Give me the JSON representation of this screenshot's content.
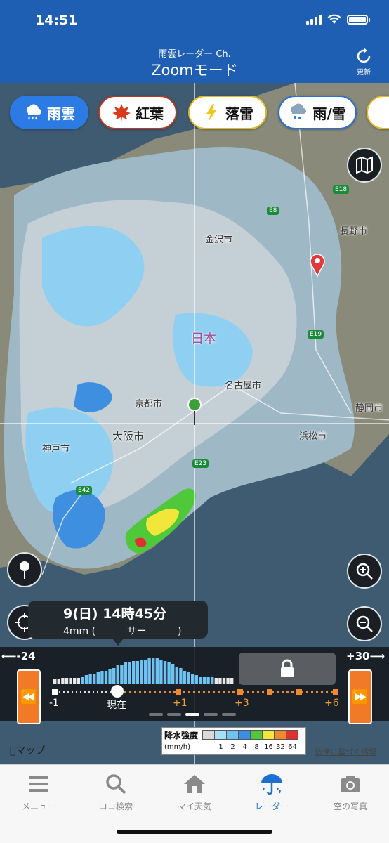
{
  "status": {
    "time": "14:51"
  },
  "header": {
    "subtitle": "雨雲レーダー Ch.",
    "title": "Zoomモード",
    "refresh_label": "更新"
  },
  "layers": [
    {
      "label": "雨雲",
      "icon": "rain-cloud-icon",
      "active": true
    },
    {
      "label": "紅葉",
      "icon": "maple-leaf-icon",
      "active": false
    },
    {
      "label": "落雷",
      "icon": "lightning-icon",
      "active": false
    },
    {
      "label": "雨/雪",
      "icon": "snow-rain-icon",
      "active": false
    }
  ],
  "map_labels": {
    "kanazawa": "金沢市",
    "nihon": "日本",
    "nagoya": "名古屋市",
    "kyoto": "京都市",
    "osaka": "大阪市",
    "kobe": "神戸市",
    "hamamatsu": "浜松市",
    "shizuoka": "静岡市",
    "nagano": "長野市",
    "e8": "E8",
    "e18": "E18",
    "e19": "E19",
    "e23": "E23",
    "e42": "E42"
  },
  "tooltip": {
    "time": "9(日) 14時45分",
    "amount": "4mm (",
    "type": "サー",
    "close": ")"
  },
  "timeline": {
    "left_label": "-24",
    "right_label": "+30",
    "ticks": {
      "minus1": "-1",
      "now": "現在",
      "plus1": "+1",
      "plus3": "+3",
      "plus6": "+6"
    }
  },
  "legend": {
    "title": "降水強度",
    "unit": "(mm/h)",
    "values": [
      "1",
      "2",
      "4",
      "8",
      "16",
      "32",
      "64"
    ],
    "colors": [
      "#d9d9d9",
      "#a6e0f7",
      "#6fc3f2",
      "#3b8de6",
      "#4fc93a",
      "#f2e63a",
      "#ef8a2c",
      "#e03030"
    ]
  },
  "attribution": {
    "maps": "マップ",
    "legal": "法律に基づく情報"
  },
  "tabs": [
    {
      "label": "メニュー",
      "icon": "menu-icon"
    },
    {
      "label": "ココ検索",
      "icon": "search-icon"
    },
    {
      "label": "マイ天気",
      "icon": "home-icon"
    },
    {
      "label": "レーダー",
      "icon": "umbrella-icon"
    },
    {
      "label": "空の写真",
      "icon": "camera-icon"
    }
  ]
}
